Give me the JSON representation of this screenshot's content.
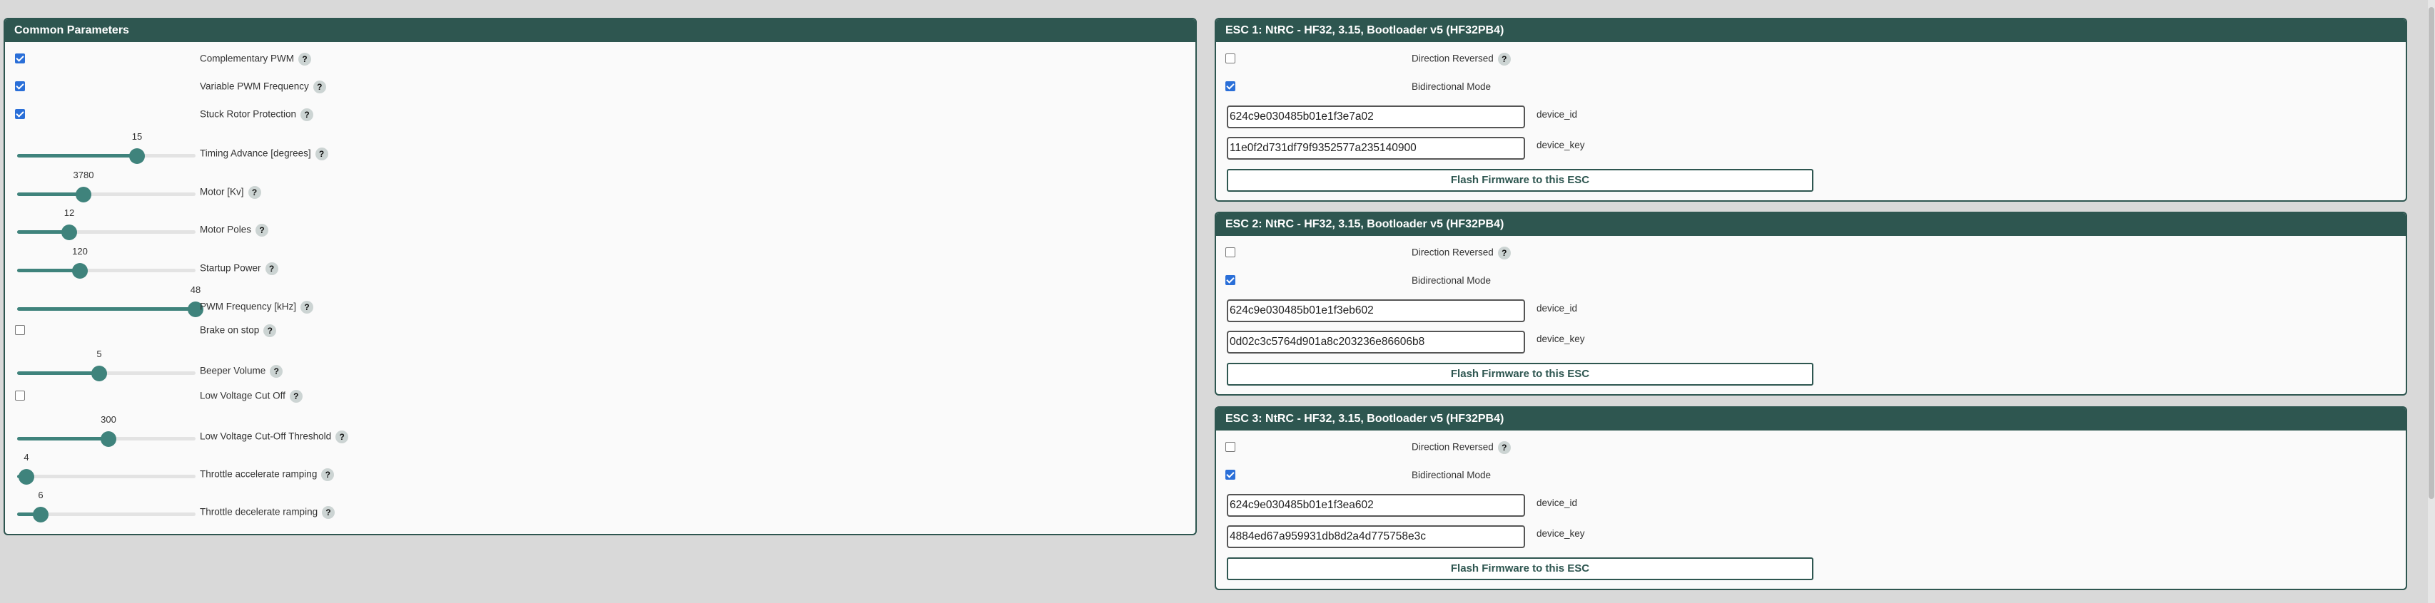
{
  "common": {
    "title": "Common Parameters",
    "complementary_pwm": {
      "label": "Complementary PWM",
      "checked": true
    },
    "variable_pwm": {
      "label": "Variable PWM Frequency",
      "checked": true
    },
    "stuck_rotor": {
      "label": "Stuck Rotor Protection",
      "checked": true
    },
    "timing_advance": {
      "label": "Timing Advance [degrees]",
      "value": "15",
      "fraction": 0.67
    },
    "motor_kv": {
      "label": "Motor [Kv]",
      "value": "3780",
      "fraction": 0.37
    },
    "motor_poles": {
      "label": "Motor Poles",
      "value": "12",
      "fraction": 0.29
    },
    "startup_power": {
      "label": "Startup Power",
      "value": "120",
      "fraction": 0.35
    },
    "pwm_frequency": {
      "label": "PWM Frequency [kHz]",
      "value": "48",
      "fraction": 1.0
    },
    "brake_on_stop": {
      "label": "Brake on stop",
      "checked": false
    },
    "beeper_volume": {
      "label": "Beeper Volume",
      "value": "5",
      "fraction": 0.46
    },
    "low_voltage_cutoff": {
      "label": "Low Voltage Cut Off",
      "checked": false
    },
    "low_voltage_threshold": {
      "label": "Low Voltage Cut-Off Threshold",
      "value": "300",
      "fraction": 0.51
    },
    "throttle_accel": {
      "label": "Throttle accelerate ramping",
      "value": "4",
      "fraction": 0.05
    },
    "throttle_decel": {
      "label": "Throttle decelerate ramping",
      "value": "6",
      "fraction": 0.13
    }
  },
  "help_glyph": "?",
  "esc": [
    {
      "title": "ESC 1: NtRC - HF32, 3.15, Bootloader v5 (HF32PB4)",
      "direction_reversed": {
        "label": "Direction Reversed",
        "checked": false
      },
      "bidirectional": {
        "label": "Bidirectional Mode",
        "checked": true
      },
      "device_id": {
        "value": "624c9e030485b01e1f3e7a02",
        "label": "device_id"
      },
      "device_key": {
        "value": "11e0f2d731df79f9352577a235140900",
        "label": "device_key"
      },
      "flash_label": "Flash Firmware to this ESC"
    },
    {
      "title": "ESC 2: NtRC - HF32, 3.15, Bootloader v5 (HF32PB4)",
      "direction_reversed": {
        "label": "Direction Reversed",
        "checked": false
      },
      "bidirectional": {
        "label": "Bidirectional Mode",
        "checked": true
      },
      "device_id": {
        "value": "624c9e030485b01e1f3eb602",
        "label": "device_id"
      },
      "device_key": {
        "value": "0d02c3c5764d901a8c203236e86606b8",
        "label": "device_key"
      },
      "flash_label": "Flash Firmware to this ESC"
    },
    {
      "title": "ESC 3: NtRC - HF32, 3.15, Bootloader v5 (HF32PB4)",
      "direction_reversed": {
        "label": "Direction Reversed",
        "checked": false
      },
      "bidirectional": {
        "label": "Bidirectional Mode",
        "checked": true
      },
      "device_id": {
        "value": "624c9e030485b01e1f3ea602",
        "label": "device_id"
      },
      "device_key": {
        "value": "4884ed67a959931db8d2a4d775758e3c",
        "label": "device_key"
      },
      "flash_label": "Flash Firmware to this ESC"
    }
  ],
  "colors": {
    "header": "#2e5650",
    "slider": "#3f837c",
    "checkbox": "#2a6fd8"
  }
}
